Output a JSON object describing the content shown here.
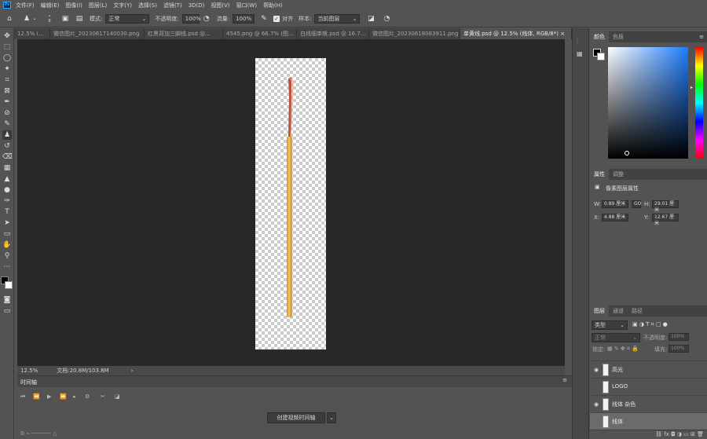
{
  "menubar": {
    "logo": "Ps",
    "items": [
      "文件(F)",
      "编辑(E)",
      "图像(I)",
      "图层(L)",
      "文字(Y)",
      "选择(S)",
      "滤镜(T)",
      "3D(D)",
      "视图(V)",
      "窗口(W)",
      "帮助(H)"
    ]
  },
  "options": {
    "mode_label": "模式:",
    "mode_value": "正常",
    "opacity_label": "不透明度:",
    "opacity_value": "100%",
    "flow_label": "流量:",
    "flow_value": "100%",
    "align_label": "对齐",
    "sample_label": "样本:",
    "sample_value": "当前图层",
    "brush_size": "9"
  },
  "tabs": [
    {
      "label": "12.5% (...",
      "active": false
    },
    {
      "label": "微信图片_20230617140030.png",
      "active": false
    },
    {
      "label": "红黑背加三脚线.psd @...",
      "active": false
    },
    {
      "label": "4545.png @ 66.7% (图...",
      "active": false
    },
    {
      "label": "白线细单根.psd @ 16.7...",
      "active": false
    },
    {
      "label": "微信图片_20230618083911.png",
      "active": false
    },
    {
      "label": "单黄线.psd @ 12.5% (线体, RGB/8*)",
      "active": true
    }
  ],
  "status": {
    "zoom": "12.5%",
    "doc_size": "文档:20.8M/103.8M"
  },
  "timeline": {
    "title": "时间轴",
    "create_button": "创建视频时间轴"
  },
  "color_panel": {
    "tabs": [
      "颜色",
      "色板"
    ],
    "accent": "#1e7cff"
  },
  "properties": {
    "tabs": [
      "属性",
      "调整"
    ],
    "title": "像素图层属性",
    "w_label": "W:",
    "w_value": "0.89 厘米",
    "link_icon": "GO",
    "h_label": "H:",
    "h_value": "29.01 厘米",
    "x_label": "X:",
    "x_value": "4.88 厘米",
    "y_label": "Y:",
    "y_value": "12.67 厘米"
  },
  "layers_panel": {
    "tabs": [
      "图层",
      "通道",
      "路径"
    ],
    "filter_value": "类型",
    "blend_value": "正常",
    "opacity_label": "不透明度:",
    "opacity_value": "100%",
    "lock_label": "锁定:",
    "fill_label": "填充:",
    "fill_value": "100%",
    "layers": [
      {
        "name": "高光",
        "visible": true,
        "selected": false
      },
      {
        "name": "LOGO",
        "visible": false,
        "selected": false
      },
      {
        "name": "线体 杂色",
        "visible": true,
        "selected": false
      },
      {
        "name": "线体",
        "visible": false,
        "selected": true
      }
    ]
  }
}
